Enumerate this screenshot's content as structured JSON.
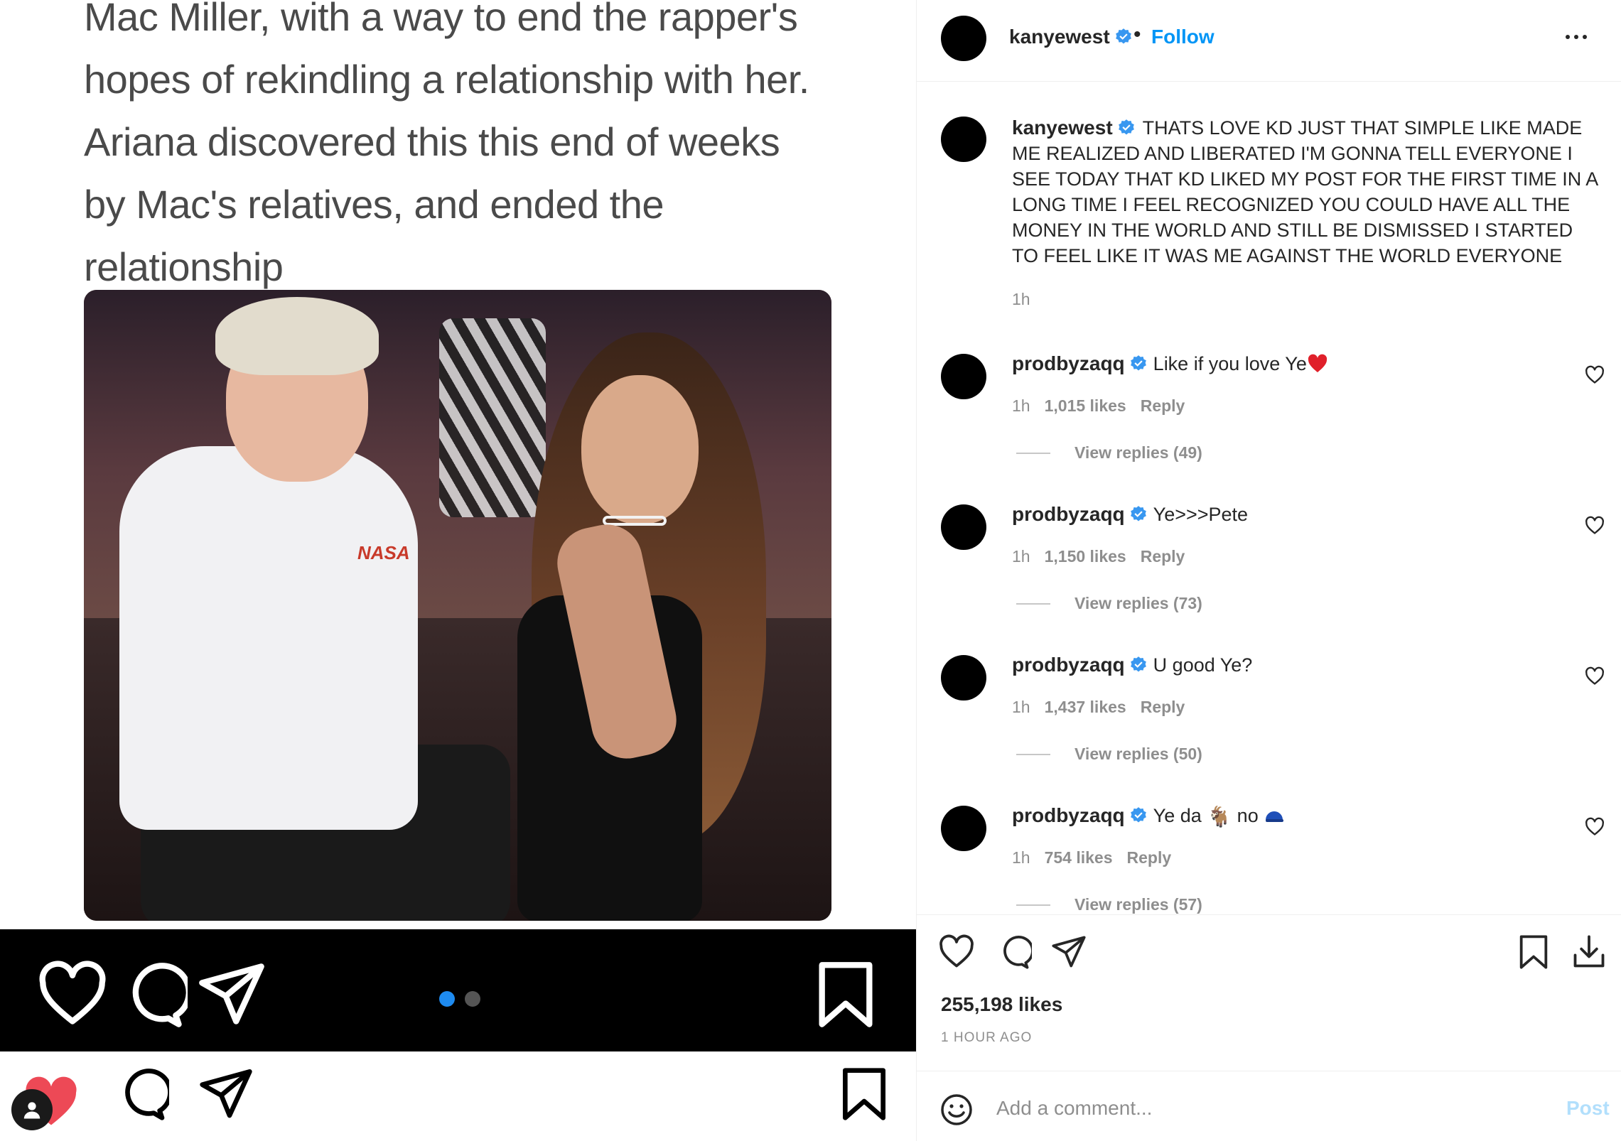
{
  "media": {
    "meme_text": [
      "Mac Miller, with a way to end the rapper's",
      "hopes of rekindling a relationship with her.",
      "Ariana discovered this this end of weeks",
      "by Mac's relatives, and ended the",
      "relationship"
    ],
    "photo_shirt_text": "NASA",
    "carousel": {
      "total": 2,
      "active": 1
    }
  },
  "post": {
    "author": "kanyewest",
    "verified": true,
    "follow_label": "Follow",
    "caption": "THATS LOVE KD JUST THAT SIMPLE LIKE MADE ME REALIZED AND LIBERATED I'M GONNA TELL EVERYONE I SEE TODAY THAT KD LIKED MY POST FOR THE FIRST TIME IN A LONG TIME I FEEL RECOGNIZED YOU COULD HAVE ALL THE MONEY IN THE WORLD AND STILL BE DISMISSED I STARTED TO FEEL LIKE IT WAS ME AGAINST THE WORLD EVERYONE",
    "caption_time": "1h",
    "likes": "255,198 likes",
    "time_ago": "1 HOUR AGO"
  },
  "comments": [
    {
      "user": "prodbyzaqq",
      "text": "Like if you love Ye",
      "time": "1h",
      "likes": "1,015 likes",
      "reply": "Reply",
      "view_replies": "View replies (49)"
    },
    {
      "user": "prodbyzaqq",
      "text": "Ye>>>Pete",
      "time": "1h",
      "likes": "1,150 likes",
      "reply": "Reply",
      "view_replies": "View replies (73)"
    },
    {
      "user": "prodbyzaqq",
      "text": "U good Ye?",
      "time": "1h",
      "likes": "1,437 likes",
      "reply": "Reply",
      "view_replies": "View replies (50)"
    },
    {
      "user": "prodbyzaqq",
      "text": "Ye da",
      "text_after": "no",
      "time": "1h",
      "likes": "754 likes",
      "reply": "Reply",
      "view_replies": "View replies (57)"
    }
  ],
  "comment_box": {
    "placeholder": "Add a comment...",
    "post_label": "Post"
  },
  "colors": {
    "accent": "#0095f6",
    "verified": "#3897f0",
    "heart": "#ed4956",
    "carousel_active": "#1e8bf0"
  },
  "icons": [
    "heart-icon",
    "comment-icon",
    "share-icon",
    "bookmark-icon",
    "download-icon",
    "more-icon",
    "smile-icon",
    "verified-icon"
  ]
}
